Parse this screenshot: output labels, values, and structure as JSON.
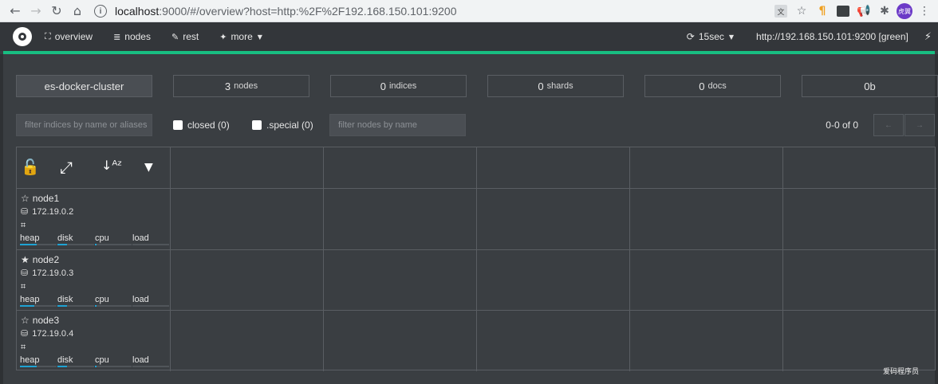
{
  "browser": {
    "url_host": "localhost",
    "url_rest": ":9000/#/overview?host=http:%2F%2F192.168.150.101:9200",
    "avatar_text": "虎翼"
  },
  "nav": {
    "items": [
      {
        "label": "overview",
        "icon": "sitemap-icon",
        "glyph": "⛶"
      },
      {
        "label": "nodes",
        "icon": "server-icon",
        "glyph": "≣"
      },
      {
        "label": "rest",
        "icon": "edit-icon",
        "glyph": "✎"
      },
      {
        "label": "more",
        "icon": "magic-wand-icon",
        "glyph": "✦"
      }
    ],
    "refresh_label": "15sec",
    "cluster_url": "http://192.168.150.101:9200 [green]"
  },
  "stats": {
    "cluster_name": "es-docker-cluster",
    "nodes_value": "3",
    "nodes_unit": "nodes",
    "indices_value": "0",
    "indices_unit": "indices",
    "shards_value": "0",
    "shards_unit": "shards",
    "docs_value": "0",
    "docs_unit": "docs",
    "size": "0b"
  },
  "filters": {
    "indices_placeholder": "filter indices by name or aliases",
    "closed_label": "closed (0)",
    "special_label": ".special (0)",
    "nodes_placeholder": "filter nodes by name",
    "pager_text": "0-0 of 0",
    "prev_label": "←",
    "next_label": "→"
  },
  "nodes": [
    {
      "name": "node1",
      "ip": "172.19.0.2",
      "master": false,
      "metrics": [
        "heap",
        "disk",
        "cpu",
        "load"
      ],
      "levels": [
        0.45,
        0.25,
        0.05,
        0.0
      ]
    },
    {
      "name": "node2",
      "ip": "172.19.0.3",
      "master": true,
      "metrics": [
        "heap",
        "disk",
        "cpu",
        "load"
      ],
      "levels": [
        0.4,
        0.25,
        0.05,
        0.0
      ]
    },
    {
      "name": "node3",
      "ip": "172.19.0.4",
      "master": false,
      "metrics": [
        "heap",
        "disk",
        "cpu",
        "load"
      ],
      "levels": [
        0.45,
        0.25,
        0.05,
        0.0
      ]
    }
  ],
  "watermark": "爱码程序员",
  "colors": {
    "accent": "#18be82",
    "bar": "#1fa3d4",
    "bg": "#3a3e42"
  }
}
